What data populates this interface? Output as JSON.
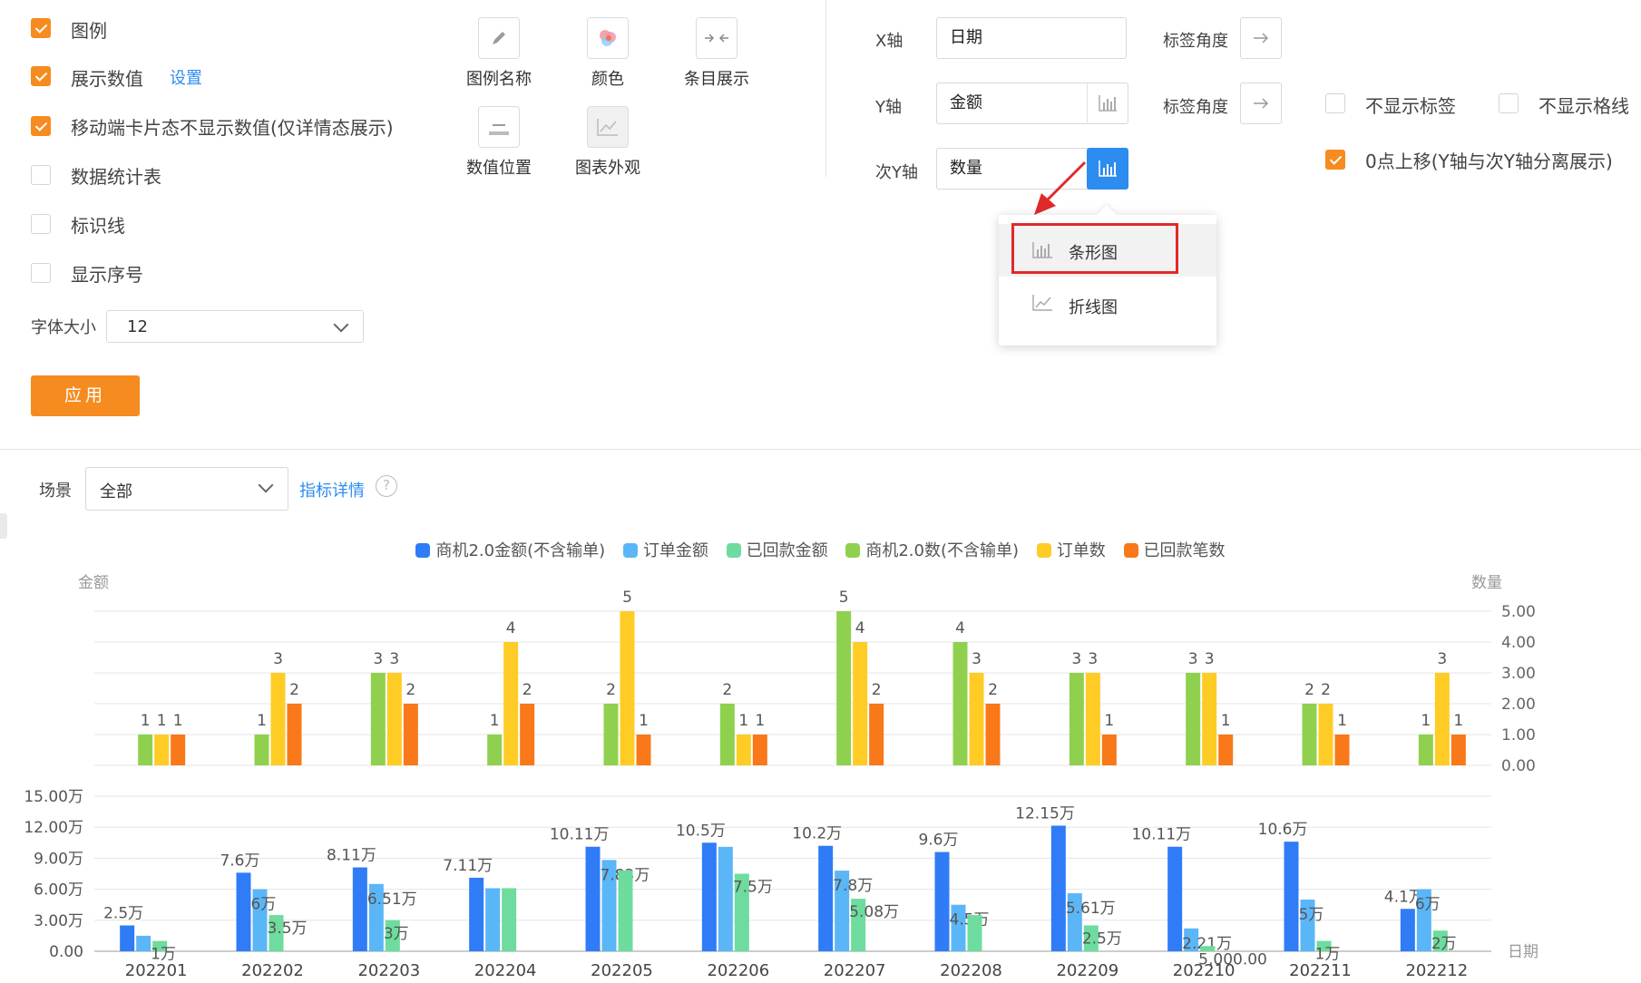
{
  "options": {
    "legend": {
      "label": "图例",
      "checked": true
    },
    "show_values": {
      "label": "展示数值",
      "checked": true,
      "settings_link": "设置"
    },
    "mobile_hide": {
      "label": "移动端卡片态不显示数值(仅详情态展示)",
      "checked": true
    },
    "data_table": {
      "label": "数据统计表",
      "checked": false
    },
    "marker_line": {
      "label": "标识线",
      "checked": false
    },
    "show_index": {
      "label": "显示序号",
      "checked": false
    },
    "font_size": {
      "label": "字体大小",
      "value": "12"
    },
    "apply_label": "应用"
  },
  "tools": [
    {
      "label": "图例名称",
      "icon": "pencil-icon"
    },
    {
      "label": "颜色",
      "icon": "color-palette-icon"
    },
    {
      "label": "条目展示",
      "icon": "collapse-arrows-icon"
    },
    {
      "label": "数值位置",
      "icon": "value-position-icon"
    },
    {
      "label": "图表外观",
      "icon": "chart-appearance-icon"
    }
  ],
  "axes": {
    "x": {
      "label": "X轴",
      "value": "日期",
      "angle_label": "标签角度"
    },
    "y": {
      "label": "Y轴",
      "value": "金额",
      "angle_label": "标签角度"
    },
    "y2": {
      "label": "次Y轴",
      "value": "数量"
    },
    "hide_labels": {
      "label": "不显示标签",
      "checked": false
    },
    "hide_grid": {
      "label": "不显示格线",
      "checked": false
    },
    "zero_shift": {
      "label": "0点上移(Y轴与次Y轴分离展示)",
      "checked": true
    }
  },
  "dropdown": {
    "items": [
      {
        "label": "条形图",
        "icon": "bar-chart-icon",
        "highlighted": true
      },
      {
        "label": "折线图",
        "icon": "line-chart-icon",
        "highlighted": false
      }
    ]
  },
  "filter": {
    "scene_label": "场景",
    "scene_value": "全部",
    "detail_link": "指标详情",
    "help_icon": "question-icon"
  },
  "chart_data": {
    "type": "bar",
    "ylabel": "金额",
    "y2label": "数量",
    "xlabel": "日期",
    "categories": [
      "202201",
      "202202",
      "202203",
      "202204",
      "202205",
      "202206",
      "202207",
      "202208",
      "202209",
      "202210",
      "202211",
      "202212"
    ],
    "y_ticks": [
      "0.00",
      "3.00万",
      "6.00万",
      "9.00万",
      "12.00万",
      "15.00万"
    ],
    "ylim": [
      0,
      15
    ],
    "y2_ticks": [
      "0.00",
      "1.00",
      "2.00",
      "3.00",
      "4.00",
      "5.00"
    ],
    "y2lim": [
      0,
      5
    ],
    "amount_series": [
      {
        "name": "商机2.0金额(不含输单)",
        "color": "#2f7cf6",
        "values": [
          2.5,
          7.6,
          8.11,
          7.11,
          10.11,
          10.5,
          10.2,
          9.6,
          12.15,
          10.11,
          10.6,
          4.1
        ],
        "labels": [
          "2.5万",
          "7.6万",
          "8.11万",
          "7.11万",
          "10.11万",
          "10.5万",
          "10.2万",
          "9.6万",
          "12.15万",
          "10.11万",
          "10.6万",
          "4.1万"
        ]
      },
      {
        "name": "订单金额",
        "color": "#5bb6f8",
        "values": [
          1.5,
          6,
          6.51,
          6.1,
          8.83,
          10.1,
          7.8,
          4.5,
          5.61,
          2.21,
          5,
          6
        ],
        "labels": [
          "",
          "6万",
          "6.51万",
          "",
          "7.83万",
          "",
          "7.8万",
          "4.5万",
          "5.61万",
          "2.21万",
          "5万",
          "6万"
        ]
      },
      {
        "name": "已回款金额",
        "color": "#6ddc9e",
        "values": [
          1,
          3.5,
          3,
          6.1,
          7.83,
          7.5,
          5.08,
          3.5,
          2.5,
          0.5,
          1,
          2
        ],
        "labels": [
          "1万",
          "3.5万",
          "3万",
          "",
          "",
          "7.5万",
          "5.08万",
          "",
          "2.5万",
          "5,000.00",
          "1万",
          "2万"
        ]
      }
    ],
    "count_series": [
      {
        "name": "商机2.0数(不含输单)",
        "color": "#8fd14f",
        "values": [
          1,
          1,
          3,
          1,
          2,
          2,
          5,
          4,
          3,
          3,
          2,
          1
        ]
      },
      {
        "name": "订单数",
        "color": "#ffcc26",
        "values": [
          1,
          3,
          3,
          4,
          5,
          1,
          4,
          3,
          3,
          3,
          2,
          3
        ]
      },
      {
        "name": "已回款笔数",
        "color": "#f8781a",
        "values": [
          1,
          2,
          2,
          2,
          1,
          1,
          2,
          2,
          1,
          1,
          1,
          1
        ]
      }
    ],
    "legend": "top"
  }
}
